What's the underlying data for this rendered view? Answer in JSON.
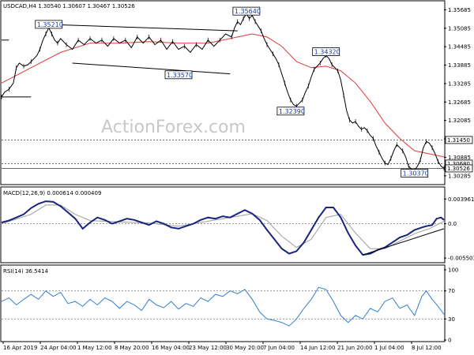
{
  "chart_data": {
    "type": "candlestick",
    "header": {
      "symbol_info": "USDCAD,H4  1.30540 1.30607 1.30467 1.30526"
    },
    "watermark": "ActionForex.com",
    "price_axis": {
      "ticks": [
        "1.35685",
        "1.35085",
        "1.34485",
        "1.33885",
        "1.33285",
        "1.32685",
        "1.32085",
        "1.31485",
        "1.30885",
        "1.30285"
      ],
      "ylim": [
        1.3005,
        1.359
      ]
    },
    "time_axis": {
      "labels": [
        "16 Apr 2019",
        "24 Apr 04:00",
        "1 May 12:00",
        "8 May 20:00",
        "16 May 04:00",
        "23 May 12:00",
        "30 May 20:00",
        "7 Jun 04:00",
        "14 Jun 12:00",
        "21 Jun 20:00",
        "1 Jul 04:00",
        "8 Jul 12:00"
      ]
    },
    "price_series": {
      "name": "USDCAD H4",
      "points": [
        [
          0,
          1.3285
        ],
        [
          2,
          1.33
        ],
        [
          5,
          1.331
        ],
        [
          8,
          1.333
        ],
        [
          10,
          1.338
        ],
        [
          12,
          1.3395
        ],
        [
          15,
          1.3385
        ],
        [
          18,
          1.339
        ],
        [
          20,
          1.34
        ],
        [
          24,
          1.342
        ],
        [
          26,
          1.344
        ],
        [
          28,
          1.347
        ],
        [
          30,
          1.349
        ],
        [
          32,
          1.351
        ],
        [
          34,
          1.349
        ],
        [
          36,
          1.347
        ],
        [
          38,
          1.346
        ],
        [
          40,
          1.3475
        ],
        [
          44,
          1.3455
        ],
        [
          48,
          1.344
        ],
        [
          52,
          1.347
        ],
        [
          56,
          1.3455
        ],
        [
          60,
          1.3475
        ],
        [
          64,
          1.346
        ],
        [
          68,
          1.347
        ],
        [
          72,
          1.345
        ],
        [
          76,
          1.3475
        ],
        [
          80,
          1.346
        ],
        [
          84,
          1.347
        ],
        [
          88,
          1.3445
        ],
        [
          92,
          1.348
        ],
        [
          96,
          1.346
        ],
        [
          100,
          1.348
        ],
        [
          104,
          1.3455
        ],
        [
          108,
          1.347
        ],
        [
          112,
          1.344
        ],
        [
          116,
          1.3465
        ],
        [
          120,
          1.344
        ],
        [
          124,
          1.345
        ],
        [
          128,
          1.343
        ],
        [
          132,
          1.3455
        ],
        [
          136,
          1.344
        ],
        [
          140,
          1.347
        ],
        [
          144,
          1.345
        ],
        [
          148,
          1.347
        ],
        [
          152,
          1.349
        ],
        [
          156,
          1.348
        ],
        [
          158,
          1.351
        ],
        [
          160,
          1.353
        ],
        [
          162,
          1.352
        ],
        [
          164,
          1.354
        ],
        [
          166,
          1.3555
        ],
        [
          168,
          1.354
        ],
        [
          170,
          1.355
        ],
        [
          172,
          1.353
        ],
        [
          174,
          1.3515
        ],
        [
          176,
          1.35
        ],
        [
          178,
          1.3475
        ],
        [
          180,
          1.3455
        ],
        [
          182,
          1.344
        ],
        [
          184,
          1.3425
        ],
        [
          186,
          1.341
        ],
        [
          188,
          1.339
        ],
        [
          190,
          1.336
        ],
        [
          192,
          1.333
        ],
        [
          194,
          1.33
        ],
        [
          196,
          1.3275
        ],
        [
          198,
          1.326
        ],
        [
          200,
          1.3255
        ],
        [
          202,
          1.3265
        ],
        [
          204,
          1.3275
        ],
        [
          206,
          1.33
        ],
        [
          208,
          1.332
        ],
        [
          210,
          1.335
        ],
        [
          212,
          1.3375
        ],
        [
          214,
          1.3385
        ],
        [
          216,
          1.3395
        ],
        [
          218,
          1.341
        ],
        [
          220,
          1.342
        ],
        [
          222,
          1.341
        ],
        [
          224,
          1.339
        ],
        [
          226,
          1.338
        ],
        [
          228,
          1.337
        ],
        [
          230,
          1.334
        ],
        [
          232,
          1.329
        ],
        [
          234,
          1.324
        ],
        [
          236,
          1.321
        ],
        [
          238,
          1.32
        ],
        [
          240,
          1.3205
        ],
        [
          242,
          1.319
        ],
        [
          244,
          1.318
        ],
        [
          246,
          1.3185
        ],
        [
          248,
          1.3175
        ],
        [
          250,
          1.316
        ],
        [
          252,
          1.315
        ],
        [
          254,
          1.3125
        ],
        [
          256,
          1.3105
        ],
        [
          258,
          1.3085
        ],
        [
          260,
          1.307
        ],
        [
          262,
          1.3065
        ],
        [
          264,
          1.3085
        ],
        [
          266,
          1.311
        ],
        [
          268,
          1.313
        ],
        [
          270,
          1.312
        ],
        [
          272,
          1.311
        ],
        [
          274,
          1.309
        ],
        [
          276,
          1.306
        ],
        [
          278,
          1.305
        ],
        [
          280,
          1.3045
        ],
        [
          282,
          1.306
        ],
        [
          284,
          1.308
        ],
        [
          286,
          1.312
        ],
        [
          288,
          1.314
        ],
        [
          290,
          1.3135
        ],
        [
          292,
          1.312
        ],
        [
          294,
          1.31
        ],
        [
          296,
          1.3075
        ],
        [
          298,
          1.306
        ],
        [
          300,
          1.3053
        ]
      ]
    },
    "ma_series": {
      "name": "MA",
      "color": "#e03a3a",
      "points": [
        [
          0,
          1.333
        ],
        [
          20,
          1.338
        ],
        [
          40,
          1.343
        ],
        [
          60,
          1.346
        ],
        [
          80,
          1.346
        ],
        [
          100,
          1.3465
        ],
        [
          120,
          1.346
        ],
        [
          140,
          1.346
        ],
        [
          160,
          1.348
        ],
        [
          170,
          1.349
        ],
        [
          180,
          1.348
        ],
        [
          190,
          1.345
        ],
        [
          200,
          1.34
        ],
        [
          210,
          1.338
        ],
        [
          220,
          1.3385
        ],
        [
          230,
          1.337
        ],
        [
          240,
          1.333
        ],
        [
          250,
          1.327
        ],
        [
          260,
          1.32
        ],
        [
          270,
          1.315
        ],
        [
          280,
          1.311
        ],
        [
          290,
          1.31
        ],
        [
          300,
          1.309
        ]
      ]
    },
    "levels": [
      {
        "label": "1.31450",
        "value": 1.3145,
        "style": "dotted",
        "tag": true
      },
      {
        "label": "1.30680",
        "value": 1.3068,
        "style": "dotted",
        "tag": true
      },
      {
        "label": "1.30526",
        "value": 1.30526,
        "style": "solid",
        "tag": true,
        "highlight": true
      }
    ],
    "annotations": [
      {
        "label": "1.35210",
        "x": 32,
        "y": 1.3521
      },
      {
        "label": "1.35640",
        "x": 166,
        "y": 1.3564
      },
      {
        "label": "1.33570",
        "x": 120,
        "y": 1.3357
      },
      {
        "label": "1.34320",
        "x": 220,
        "y": 1.3432
      },
      {
        "label": "1.32390",
        "x": 196,
        "y": 1.3239
      },
      {
        "label": "1.30370",
        "x": 280,
        "y": 1.3037
      }
    ],
    "trendlines": [
      {
        "points": [
          [
            0,
            1.347
          ],
          [
            5,
            1.347
          ]
        ]
      },
      {
        "points": [
          [
            0,
            1.3285
          ],
          [
            20,
            1.3285
          ]
        ]
      },
      {
        "points": [
          [
            30,
            1.3521
          ],
          [
            160,
            1.35
          ]
        ]
      },
      {
        "points": [
          [
            48,
            1.3395
          ],
          [
            155,
            1.336
          ]
        ]
      }
    ],
    "macd": {
      "label": "MACD(12,26,9) 0.000614 0.000409",
      "ticks": [
        "0.003961",
        "0.0",
        "-0.005503"
      ],
      "ylim": [
        -0.006,
        0.0045
      ],
      "macd_color": "#1a237e",
      "signal_color": "#9e9e9e",
      "macd_points": [
        [
          0,
          0.0002
        ],
        [
          5,
          0.0005
        ],
        [
          10,
          0.001
        ],
        [
          15,
          0.0015
        ],
        [
          20,
          0.0025
        ],
        [
          25,
          0.0032
        ],
        [
          30,
          0.0036
        ],
        [
          35,
          0.0035
        ],
        [
          40,
          0.0028
        ],
        [
          45,
          0.0018
        ],
        [
          50,
          0.0008
        ],
        [
          55,
          -0.0008
        ],
        [
          60,
          0.0002
        ],
        [
          65,
          0.001
        ],
        [
          70,
          0.0006
        ],
        [
          75,
          0.0
        ],
        [
          80,
          0.0004
        ],
        [
          85,
          0.0008
        ],
        [
          90,
          0.0006
        ],
        [
          95,
          0.0002
        ],
        [
          100,
          -0.0002
        ],
        [
          105,
          0.0004
        ],
        [
          110,
          0.0
        ],
        [
          115,
          -0.0006
        ],
        [
          120,
          -0.0008
        ],
        [
          125,
          -0.0004
        ],
        [
          130,
          0.0
        ],
        [
          135,
          0.0006
        ],
        [
          140,
          0.001
        ],
        [
          145,
          0.0008
        ],
        [
          150,
          0.0012
        ],
        [
          155,
          0.001
        ],
        [
          160,
          0.0016
        ],
        [
          165,
          0.0022
        ],
        [
          170,
          0.0016
        ],
        [
          175,
          0.0006
        ],
        [
          180,
          -0.001
        ],
        [
          185,
          -0.0025
        ],
        [
          190,
          -0.004
        ],
        [
          195,
          -0.0048
        ],
        [
          200,
          -0.0044
        ],
        [
          205,
          -0.003
        ],
        [
          210,
          -0.001
        ],
        [
          215,
          0.001
        ],
        [
          220,
          0.0026
        ],
        [
          225,
          0.0026
        ],
        [
          230,
          0.001
        ],
        [
          235,
          -0.0015
        ],
        [
          240,
          -0.0035
        ],
        [
          245,
          -0.005
        ],
        [
          250,
          -0.0048
        ],
        [
          255,
          -0.0042
        ],
        [
          260,
          -0.0038
        ],
        [
          265,
          -0.003
        ],
        [
          270,
          -0.0022
        ],
        [
          275,
          -0.0018
        ],
        [
          280,
          -0.001
        ],
        [
          285,
          -0.0006
        ],
        [
          288,
          -0.0004
        ],
        [
          292,
          -0.0002
        ],
        [
          295,
          0.0008
        ],
        [
          298,
          0.001
        ],
        [
          300,
          0.0006
        ]
      ],
      "signal_points": [
        [
          0,
          0.0
        ],
        [
          20,
          0.0015
        ],
        [
          30,
          0.003
        ],
        [
          40,
          0.003
        ],
        [
          50,
          0.0015
        ],
        [
          60,
          0.0005
        ],
        [
          80,
          0.0003
        ],
        [
          100,
          0.0001
        ],
        [
          120,
          -0.0004
        ],
        [
          140,
          0.0004
        ],
        [
          160,
          0.0012
        ],
        [
          170,
          0.0016
        ],
        [
          180,
          0.0005
        ],
        [
          190,
          -0.002
        ],
        [
          200,
          -0.0038
        ],
        [
          210,
          -0.0025
        ],
        [
          220,
          0.001
        ],
        [
          230,
          0.0015
        ],
        [
          240,
          -0.0015
        ],
        [
          250,
          -0.004
        ],
        [
          260,
          -0.004
        ],
        [
          270,
          -0.0028
        ],
        [
          280,
          -0.0016
        ],
        [
          290,
          -0.0008
        ],
        [
          300,
          0.0004
        ]
      ],
      "trendline": [
        [
          245,
          -0.005
        ],
        [
          300,
          -0.0008
        ]
      ]
    },
    "rsi": {
      "label": "RSI(14) 36.5414",
      "ticks": [
        "100",
        "70",
        "30",
        "0"
      ],
      "ylim": [
        0,
        100
      ],
      "levels": [
        70,
        30
      ],
      "color": "#2f7fd0",
      "points": [
        [
          0,
          55
        ],
        [
          5,
          60
        ],
        [
          10,
          50
        ],
        [
          15,
          58
        ],
        [
          20,
          65
        ],
        [
          25,
          58
        ],
        [
          30,
          70
        ],
        [
          35,
          62
        ],
        [
          40,
          68
        ],
        [
          45,
          52
        ],
        [
          50,
          55
        ],
        [
          55,
          48
        ],
        [
          60,
          58
        ],
        [
          65,
          50
        ],
        [
          70,
          60
        ],
        [
          75,
          55
        ],
        [
          80,
          45
        ],
        [
          85,
          55
        ],
        [
          90,
          50
        ],
        [
          95,
          42
        ],
        [
          100,
          58
        ],
        [
          105,
          50
        ],
        [
          110,
          46
        ],
        [
          115,
          55
        ],
        [
          120,
          44
        ],
        [
          125,
          52
        ],
        [
          130,
          48
        ],
        [
          135,
          60
        ],
        [
          140,
          55
        ],
        [
          145,
          65
        ],
        [
          150,
          62
        ],
        [
          155,
          70
        ],
        [
          160,
          66
        ],
        [
          165,
          72
        ],
        [
          170,
          58
        ],
        [
          175,
          40
        ],
        [
          180,
          30
        ],
        [
          185,
          28
        ],
        [
          190,
          25
        ],
        [
          195,
          20
        ],
        [
          200,
          30
        ],
        [
          205,
          45
        ],
        [
          210,
          58
        ],
        [
          215,
          75
        ],
        [
          220,
          72
        ],
        [
          225,
          55
        ],
        [
          230,
          35
        ],
        [
          235,
          25
        ],
        [
          240,
          35
        ],
        [
          245,
          30
        ],
        [
          250,
          45
        ],
        [
          255,
          40
        ],
        [
          260,
          55
        ],
        [
          265,
          60
        ],
        [
          270,
          45
        ],
        [
          275,
          50
        ],
        [
          280,
          35
        ],
        [
          285,
          62
        ],
        [
          288,
          70
        ],
        [
          292,
          58
        ],
        [
          296,
          48
        ],
        [
          300,
          36.5
        ]
      ]
    }
  }
}
